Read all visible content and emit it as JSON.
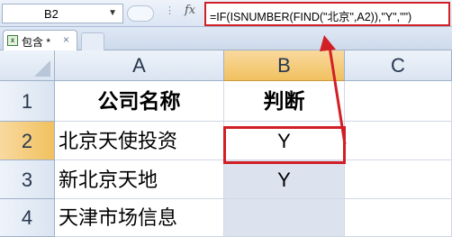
{
  "formula_bar": {
    "name_box": "B2",
    "fx_label": "fx",
    "formula": "=IF(ISNUMBER(FIND(\"北京\",A2)),\"Y\",\"\")"
  },
  "sheet_tab": {
    "label": "包含 *",
    "close": "×"
  },
  "columns": [
    "A",
    "B",
    "C"
  ],
  "rows": [
    "1",
    "2",
    "3",
    "4"
  ],
  "cells": {
    "A1": "公司名称",
    "B1": "判断",
    "A2": "北京天使投资",
    "B2": "Y",
    "A3": "新北京天地",
    "B3": "Y",
    "A4": "天津市场信息",
    "B4": ""
  },
  "colors": {
    "highlight": "#d21f26",
    "selected_header": "#f1c15f",
    "shaded_cell": "#dde3ee"
  }
}
